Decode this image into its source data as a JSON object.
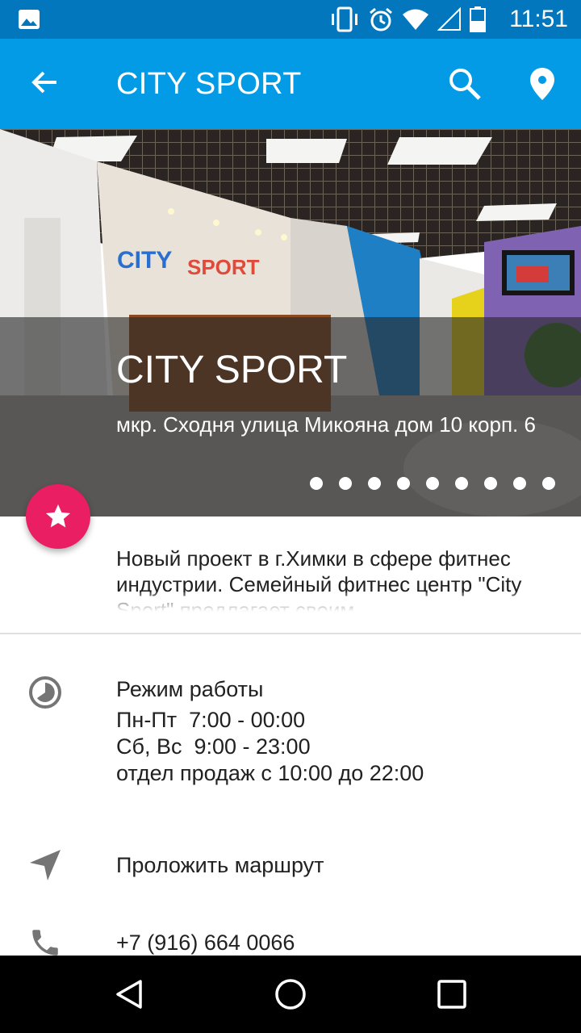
{
  "status_bar": {
    "time": "11:51",
    "icons": [
      "image-icon",
      "vibrate-icon",
      "alarm-icon",
      "wifi-icon",
      "signal-icon",
      "battery-icon"
    ]
  },
  "app_bar": {
    "title": "CITY SPORT",
    "icons": [
      "back-arrow-icon",
      "search-icon",
      "location-pin-icon"
    ],
    "color": "#039be5",
    "status_color": "#0277bd"
  },
  "hero": {
    "name": "CITY SPORT",
    "address": "мкр. Сходня улица Микояна дом 10 корп. 6",
    "page_count": 9
  },
  "fab": {
    "icon": "star-icon",
    "color": "#e91e63"
  },
  "description": {
    "text": "Новый проект в г.Химки в сфере фитнес индустрии. Семейный фитнес центр \"City Sport\" предлагает своим"
  },
  "hours": {
    "icon": "clock-icon",
    "title": "Режим работы",
    "lines": [
      "Пн-Пт  7:00 - 00:00",
      "Сб, Вс  9:00 - 23:00",
      "отдел продаж с 10:00 до 22:00"
    ]
  },
  "route": {
    "icon": "navigation-icon",
    "label": "Проложить маршрут"
  },
  "phone": {
    "icon": "phone-icon",
    "label": "+7 (916) 664 0066"
  },
  "nav_bar": {
    "icons": [
      "back-triangle-icon",
      "home-circle-icon",
      "recents-square-icon"
    ]
  }
}
